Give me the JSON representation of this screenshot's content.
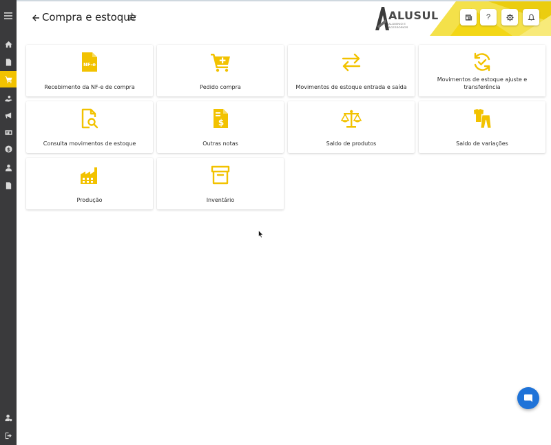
{
  "header": {
    "title": "Compra e estoque",
    "brand": {
      "name": "ALUSUL",
      "tagline": "ALUMINIO E ACESSORIOS",
      "accent": "#f2c200"
    }
  },
  "header_buttons": [
    {
      "name": "news",
      "icon": "newspaper-icon"
    },
    {
      "name": "help",
      "icon": "question-icon",
      "label": "?"
    },
    {
      "name": "settings",
      "icon": "gear-icon"
    },
    {
      "name": "notifications",
      "icon": "bell-icon"
    }
  ],
  "sidebar": {
    "items": [
      {
        "icon": "menu-icon"
      },
      {
        "icon": "home-icon"
      },
      {
        "icon": "document-icon"
      },
      {
        "icon": "cart-icon",
        "active": true
      },
      {
        "icon": "hand-coin-icon"
      },
      {
        "icon": "megaphone-icon"
      },
      {
        "icon": "id-card-icon"
      },
      {
        "icon": "dollar-icon"
      },
      {
        "icon": "users-icon"
      },
      {
        "icon": "file-icon"
      },
      {
        "icon": "user-settings-icon"
      },
      {
        "icon": "logout-icon"
      }
    ]
  },
  "cards": [
    {
      "label": "Recebimento da NF-e de compra",
      "icon": "nfe-icon",
      "icon_text": "NF-e"
    },
    {
      "label": "Pedido compra",
      "icon": "cart-plus-icon"
    },
    {
      "label": "Movimentos de estoque entrada e saída",
      "icon": "swap-arrows-icon"
    },
    {
      "label": "Movimentos de estoque ajuste e transferência",
      "icon": "refresh-check-icon"
    },
    {
      "label": "Consulta movimentos de estoque",
      "icon": "file-search-icon"
    },
    {
      "label": "Outras notas",
      "icon": "invoice-dollar-icon"
    },
    {
      "label": "Saldo de produtos",
      "icon": "scale-icon"
    },
    {
      "label": "Saldo de variações",
      "icon": "clothes-icon"
    },
    {
      "label": "Produção",
      "icon": "factory-icon"
    },
    {
      "label": "Inventário",
      "icon": "archive-box-icon"
    }
  ],
  "colors": {
    "accent": "#f2c200",
    "sidebar": "#3a3a3c",
    "chat": "#1f73d8"
  }
}
